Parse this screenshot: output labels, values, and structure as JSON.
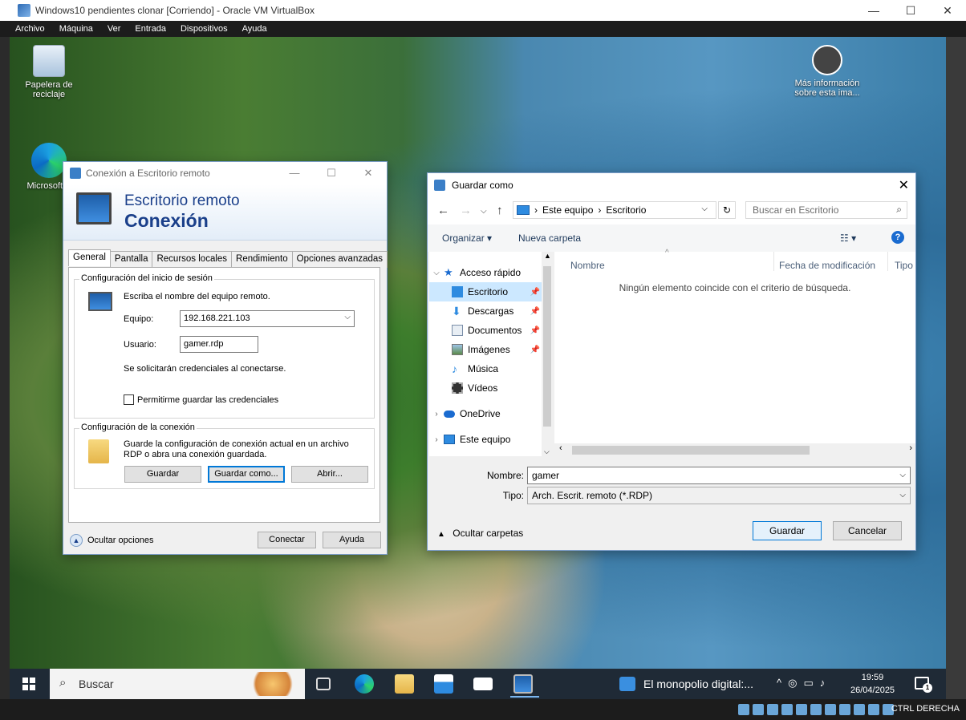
{
  "vbox": {
    "title": "Windows10 pendientes clonar [Corriendo] - Oracle VM VirtualBox",
    "menu": [
      "Archivo",
      "Máquina",
      "Ver",
      "Entrada",
      "Dispositivos",
      "Ayuda"
    ],
    "window_controls": {
      "minimize": "—",
      "maximize": "☐",
      "close": "✕"
    },
    "hostkey": "CTRL DERECHA"
  },
  "desktop": {
    "recycle_bin": "Papelera de reciclaje",
    "edge": "Microsoft E",
    "info": "Más información sobre esta ima..."
  },
  "rdp": {
    "title": "Conexión a Escritorio remoto",
    "banner_line1": "Escritorio remoto",
    "banner_line2": "Conexión",
    "tabs": [
      "General",
      "Pantalla",
      "Recursos locales",
      "Rendimiento",
      "Opciones avanzadas"
    ],
    "login_group": "Configuración del inicio de sesión",
    "login_hint": "Escriba el nombre del equipo remoto.",
    "equipo_label": "Equipo:",
    "equipo_value": "192.168.221.103",
    "usuario_label": "Usuario:",
    "usuario_value": "gamer.rdp",
    "credentials_note": "Se solicitarán credenciales al conectarse.",
    "save_creds_label": "Permitirme guardar las credenciales",
    "conn_group": "Configuración de la conexión",
    "conn_hint1": "Guarde la configuración de conexión actual en un archivo",
    "conn_hint2": "RDP o abra una conexión guardada.",
    "btn_save": "Guardar",
    "btn_save_as": "Guardar como...",
    "btn_open": "Abrir...",
    "hide_options": "Ocultar opciones",
    "btn_connect": "Conectar",
    "btn_help": "Ayuda"
  },
  "saveas": {
    "title": "Guardar como",
    "path": [
      "Este equipo",
      "Escritorio"
    ],
    "search_placeholder": "Buscar en Escritorio",
    "organize": "Organizar ▾",
    "new_folder": "Nueva carpeta",
    "nav": {
      "quick_access": "Acceso rápido",
      "items": [
        "Escritorio",
        "Descargas",
        "Documentos",
        "Imágenes",
        "Música",
        "Vídeos"
      ],
      "onedrive": "OneDrive",
      "this_pc": "Este equipo"
    },
    "columns": [
      "Nombre",
      "Fecha de modificación",
      "Tipo"
    ],
    "empty_message": "Ningún elemento coincide con el criterio de búsqueda.",
    "name_label": "Nombre:",
    "name_value": "gamer",
    "type_label": "Tipo:",
    "type_value": "Arch. Escrit. remoto (*.RDP)",
    "hide_folders": "Ocultar carpetas",
    "btn_save": "Guardar",
    "btn_cancel": "Cancelar"
  },
  "taskbar": {
    "search_placeholder": "Buscar",
    "news": "El monopolio digital:...",
    "time": "19:59",
    "date": "26/04/2025",
    "notif_count": "1"
  }
}
